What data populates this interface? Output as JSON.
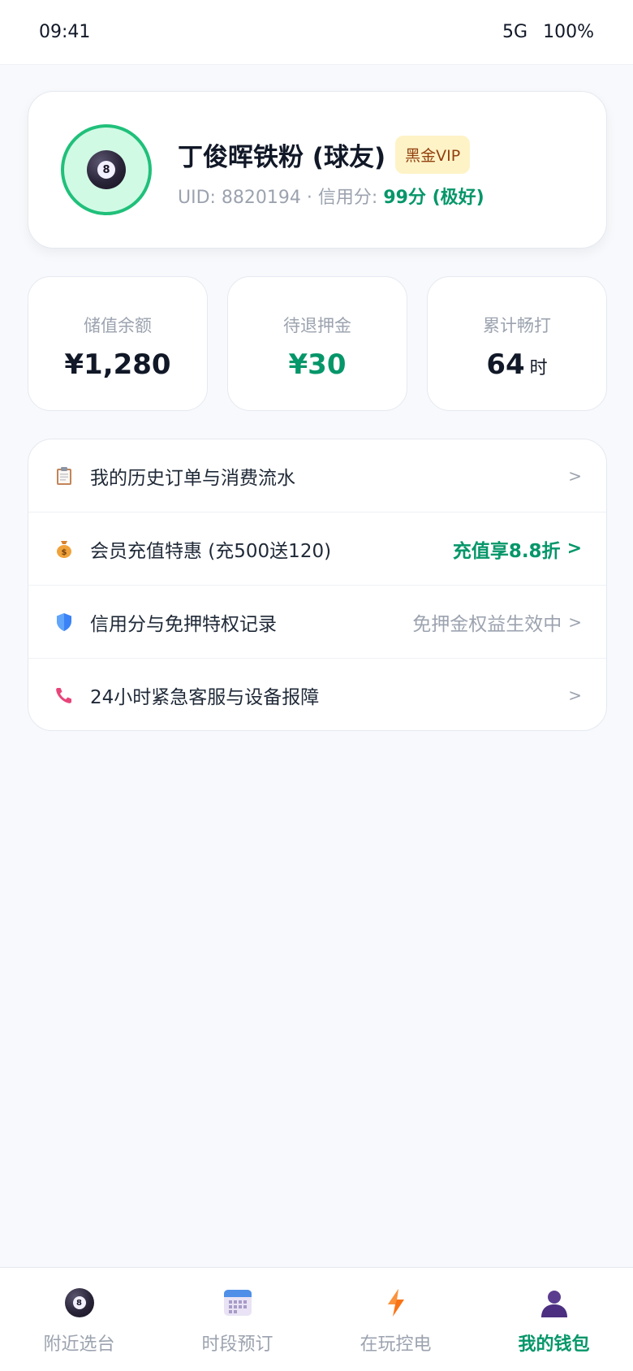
{
  "status_bar": {
    "time": "09:41",
    "network": "5G",
    "battery": "100%"
  },
  "profile": {
    "name": "丁俊晖铁粉 (球友)",
    "vip_badge": "黑金VIP",
    "avatar_ball_number": "8",
    "uid_text": "UID: 8820194 · 信用分: ",
    "credit_score": "99分 (极好)"
  },
  "stats": [
    {
      "label": "储值余额",
      "value": "¥1,280",
      "unit": ""
    },
    {
      "label": "待退押金",
      "value": "¥30",
      "unit": ""
    },
    {
      "label": "累计畅打",
      "value": "64",
      "unit": "时"
    }
  ],
  "menu": [
    {
      "icon": "clipboard-icon",
      "label": "我的历史订单与消费流水",
      "right": "",
      "chevron": ">"
    },
    {
      "icon": "money-bag-icon",
      "label": "会员充值特惠 (充500送120)",
      "right": "充值享8.8折",
      "chevron": ">"
    },
    {
      "icon": "shield-icon",
      "label": "信用分与免押特权记录",
      "right": "免押金权益生效中",
      "chevron": ">"
    },
    {
      "icon": "phone-icon",
      "label": "24小时紧急客服与设备报障",
      "right": "",
      "chevron": ">"
    }
  ],
  "tabs": [
    {
      "icon": "billiard-ball-icon",
      "label": "附近选台",
      "active": false
    },
    {
      "icon": "calendar-icon",
      "label": "时段预订",
      "active": false
    },
    {
      "icon": "lightning-icon",
      "label": "在玩控电",
      "active": false
    },
    {
      "icon": "user-icon",
      "label": "我的钱包",
      "active": true
    }
  ],
  "colors": {
    "accent": "#059669",
    "vip_bg": "#fef3c7",
    "vip_text": "#92400e",
    "avatar_ring": "#20c07a"
  }
}
